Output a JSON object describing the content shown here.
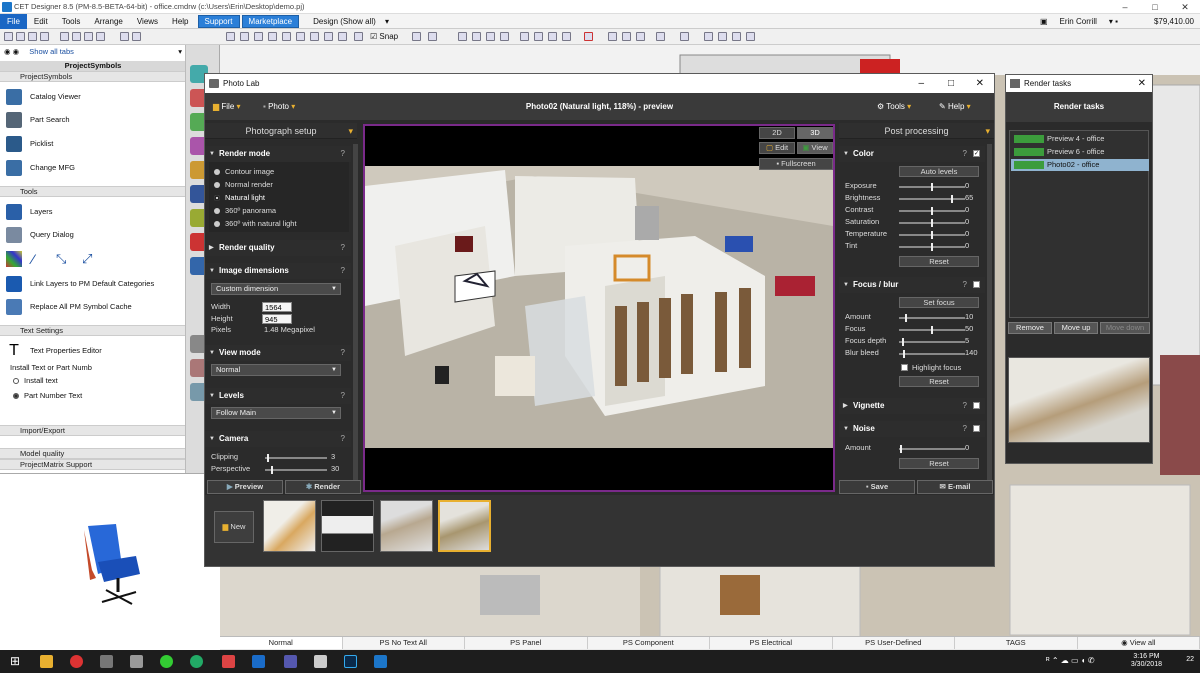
{
  "app": {
    "title": "CET Designer 8.5 (PM-8.5-BETA-64-bit) - office.cmdrw (c:\\Users\\Erin\\Desktop\\demo.pj)",
    "menu": [
      "File",
      "Edit",
      "Tools",
      "Arrange",
      "Views",
      "Help"
    ],
    "menu_buttons": [
      "Support",
      "Marketplace"
    ],
    "design_dropdown": "Design (Show all)",
    "user_name": "Erin Corrill",
    "balance": "$79,410.00",
    "snap_label": "Snap"
  },
  "left_panel": {
    "tabs_dropdown": "Show all tabs",
    "header": "ProjectSymbols",
    "sections": {
      "project_symbols": "ProjectSymbols",
      "tools": "Tools",
      "text_settings": "Text Settings",
      "import_export": "Import/Export",
      "model_quality": "Model quality",
      "project_matrix": "ProjectMatrix Support"
    },
    "project_symbols_items": [
      "Catalog Viewer",
      "Part Search",
      "Picklist",
      "Change MFG"
    ],
    "tools_items": [
      "Layers",
      "Query Dialog",
      "Link Layers to PM Default Categories",
      "Replace All PM Symbol Cache"
    ],
    "text_settings": {
      "editor": "Text Properties Editor",
      "group_label": "Install Text or Part Numb",
      "options": [
        "Install text",
        "Part Number Text"
      ]
    }
  },
  "photolab": {
    "title": "Photo Lab",
    "menu": {
      "file": "File",
      "photo": "Photo",
      "tools": "Tools",
      "help": "Help"
    },
    "doc_title": "Photo02 (Natural light, 118%) - preview",
    "photograph_setup": "Photograph setup",
    "render_mode": {
      "label": "Render mode",
      "options": [
        "Contour image",
        "Normal render",
        "Natural light",
        "360º panorama",
        "360º with natural light"
      ],
      "selected": "Natural light"
    },
    "render_quality": "Render quality",
    "image_dimensions": {
      "label": "Image dimensions",
      "preset": "Custom dimension",
      "width_label": "Width",
      "width": "1564",
      "height_label": "Height",
      "height": "945",
      "pixels_label": "Pixels",
      "pixels": "1.48 Megapixel"
    },
    "view_mode": {
      "label": "View mode",
      "value": "Normal"
    },
    "levels": {
      "label": "Levels",
      "value": "Follow Main"
    },
    "camera": {
      "label": "Camera",
      "clipping_label": "Clipping",
      "clipping": "3",
      "perspective_label": "Perspective",
      "perspective": "30"
    },
    "viewport_buttons": {
      "two_d": "2D",
      "three_d": "3D",
      "edit": "Edit",
      "view": "View",
      "fullscreen": "Fullscreen"
    },
    "post_processing": "Post processing",
    "color": {
      "label": "Color",
      "auto_levels": "Auto levels",
      "rows": [
        {
          "label": "Exposure",
          "value": "0",
          "pos": 0.5
        },
        {
          "label": "Brightness",
          "value": "65",
          "pos": 0.82
        },
        {
          "label": "Contrast",
          "value": "0",
          "pos": 0.5
        },
        {
          "label": "Saturation",
          "value": "0",
          "pos": 0.5
        },
        {
          "label": "Temperature",
          "value": "0",
          "pos": 0.5
        },
        {
          "label": "Tint",
          "value": "0",
          "pos": 0.5
        }
      ],
      "reset": "Reset"
    },
    "focus_blur": {
      "label": "Focus / blur",
      "set_focus": "Set focus",
      "rows": [
        {
          "label": "Amount",
          "value": "10",
          "pos": 0.1
        },
        {
          "label": "Focus",
          "value": "50",
          "pos": 0.5
        },
        {
          "label": "Focus depth",
          "value": "5",
          "pos": 0.05
        },
        {
          "label": "Blur bleed",
          "value": "140",
          "pos": 0.07
        }
      ],
      "highlight_focus": "Highlight focus",
      "reset": "Reset"
    },
    "vignette": "Vignette",
    "noise": {
      "label": "Noise",
      "amount_label": "Amount",
      "amount": "0",
      "reset": "Reset"
    },
    "bottom_buttons": {
      "preview": "Preview",
      "render": "Render",
      "save": "Save",
      "email": "E-mail"
    },
    "new_button": "New"
  },
  "render_tasks": {
    "title": "Render tasks",
    "header": "Render tasks",
    "items": [
      "Preview 4 - office",
      "Preview 6 - office",
      "Photo02 - office"
    ],
    "selected_index": 2,
    "buttons": {
      "remove": "Remove",
      "move_up": "Move up",
      "move_down": "Move down"
    }
  },
  "bottom_tabs": [
    "Normal",
    "PS No Text All",
    "PS Panel",
    "PS Component",
    "PS Electrical",
    "PS User-Defined",
    "TAGS",
    "View all"
  ],
  "taskbar": {
    "time": "3:16 PM",
    "date": "3/30/2018",
    "notifications": "22"
  },
  "colors": {
    "accent": "#1a66c4",
    "viewport_border": "#7a2a8a",
    "task_green": "#3c9c3c",
    "selected_row": "#8fb3cf"
  }
}
